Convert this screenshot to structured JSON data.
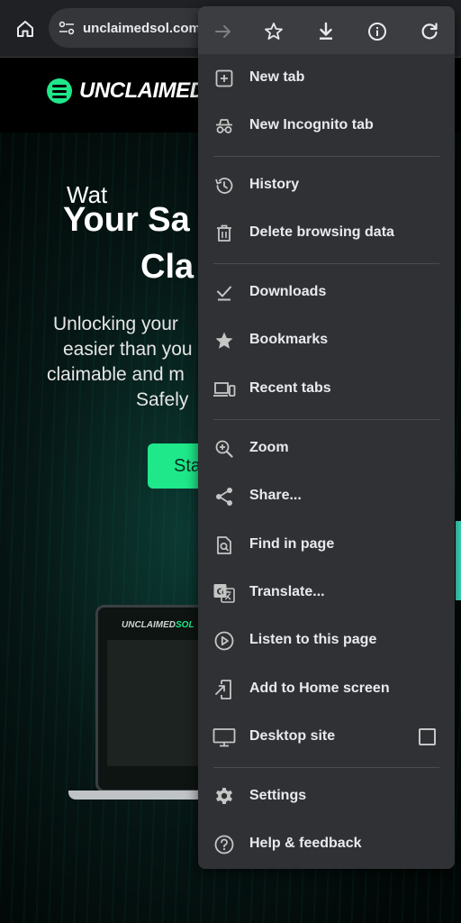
{
  "browser": {
    "url": "unclaimedsol.com"
  },
  "site": {
    "logo_text": "UNCLAIMED",
    "logo_accent": "SO",
    "hero_line1": "Your Sa",
    "hero_line2": "Cla",
    "para_lines": [
      "Unlocking your",
      "easier than you",
      "claimable and m",
      "Safely"
    ],
    "cta_label": "Sta",
    "laptop_logo": "UNCLAIMED",
    "laptop_logo_accent": "SOL",
    "laptop_text": "Wat"
  },
  "menu": {
    "actions": [
      {
        "name": "forward-icon"
      },
      {
        "name": "bookmark-star-icon"
      },
      {
        "name": "download-icon"
      },
      {
        "name": "page-info-icon"
      },
      {
        "name": "reload-icon"
      }
    ],
    "items": [
      {
        "label": "New tab",
        "icon": "new-tab-icon"
      },
      {
        "label": "New Incognito tab",
        "icon": "incognito-icon"
      },
      {
        "label": "History",
        "icon": "history-icon"
      },
      {
        "label": "Delete browsing data",
        "icon": "trash-icon"
      },
      {
        "label": "Downloads",
        "icon": "downloads-icon"
      },
      {
        "label": "Bookmarks",
        "icon": "star-icon"
      },
      {
        "label": "Recent tabs",
        "icon": "devices-icon"
      },
      {
        "label": "Zoom",
        "icon": "zoom-icon"
      },
      {
        "label": "Share...",
        "icon": "share-icon"
      },
      {
        "label": "Find in page",
        "icon": "find-in-page-icon"
      },
      {
        "label": "Translate...",
        "icon": "translate-icon"
      },
      {
        "label": "Listen to this page",
        "icon": "play-circle-icon"
      },
      {
        "label": "Add to Home screen",
        "icon": "add-to-home-icon"
      },
      {
        "label": "Desktop site",
        "icon": "desktop-icon",
        "checked": false
      },
      {
        "label": "Settings",
        "icon": "settings-icon"
      },
      {
        "label": "Help & feedback",
        "icon": "help-icon"
      }
    ]
  },
  "colors": {
    "brand_green": "#1ee88a",
    "menu_bg": "#303134",
    "menu_text": "#e8eaed"
  }
}
